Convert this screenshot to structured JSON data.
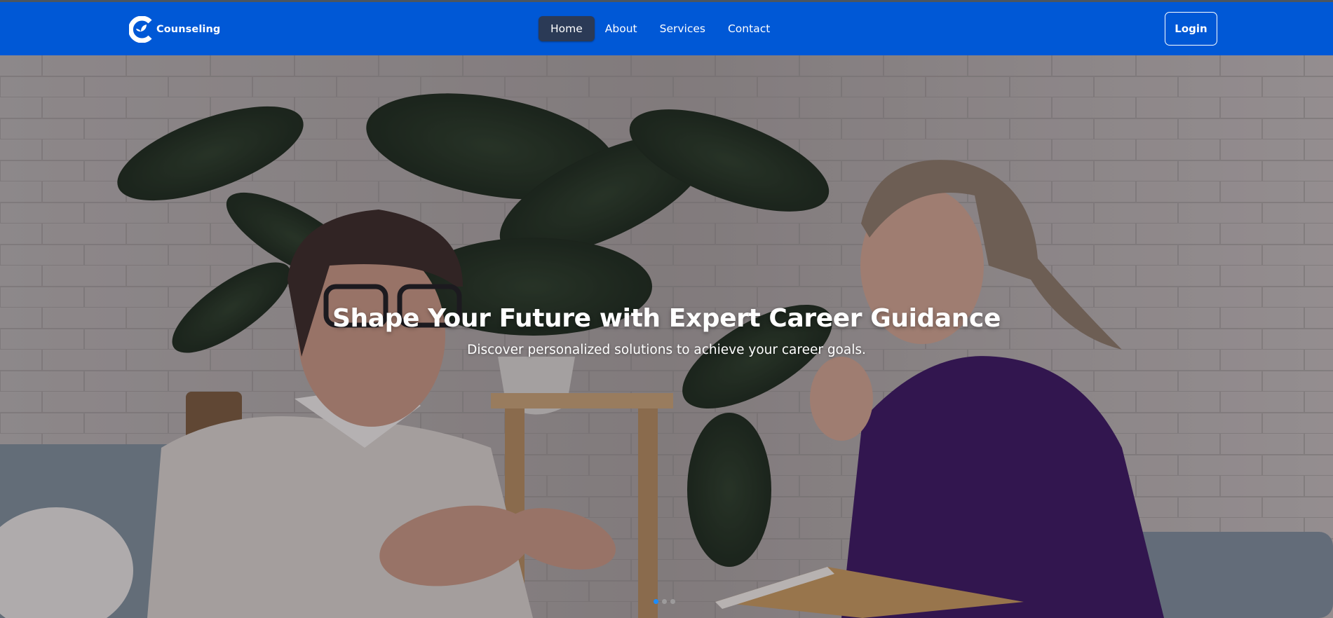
{
  "brand": {
    "name": "Counseling",
    "logo_letter": "C",
    "icon": "leaf-c-logo-icon"
  },
  "nav": {
    "links": [
      {
        "label": "Home",
        "active": true
      },
      {
        "label": "About",
        "active": false
      },
      {
        "label": "Services",
        "active": false
      },
      {
        "label": "Contact",
        "active": false
      }
    ],
    "login_label": "Login"
  },
  "hero": {
    "title": "Shape Your Future with Expert Career Guidance",
    "subtitle": "Discover personalized solutions to achieve your career goals.",
    "slides": {
      "count": 3,
      "active_index": 0
    }
  },
  "colors": {
    "navbar": "#0058d6",
    "active_link_bg": "#2b3a56",
    "active_dot": "#1a8cff",
    "text_on_dark": "#ffffff"
  }
}
